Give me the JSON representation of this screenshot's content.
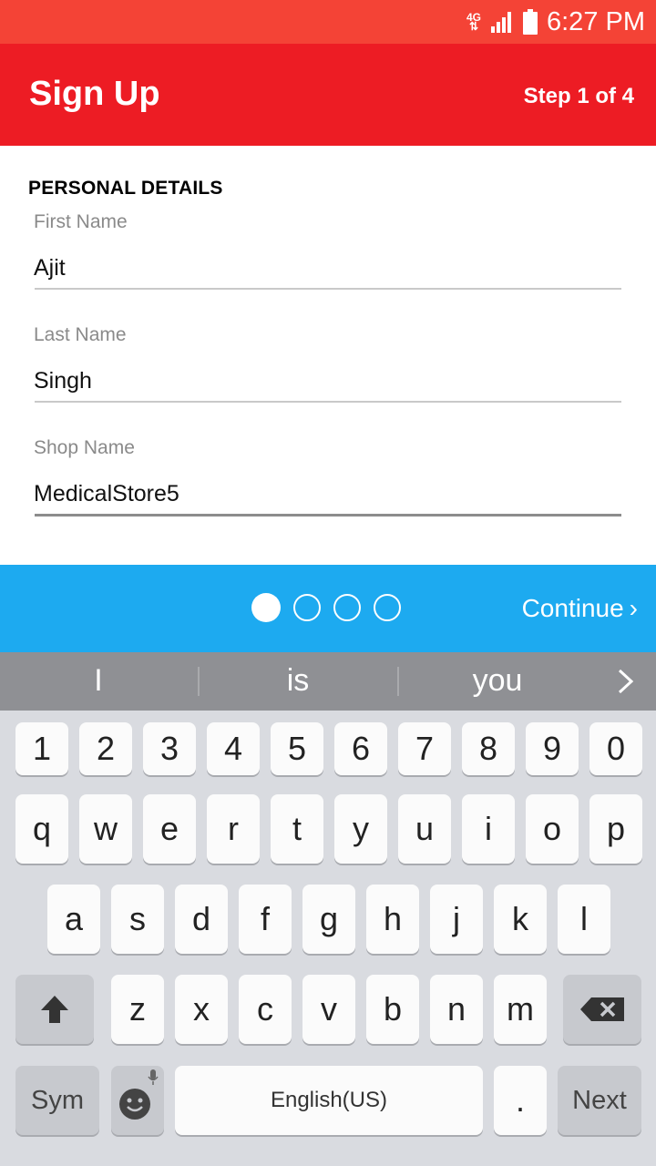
{
  "status": {
    "network": "4G",
    "time": "6:27 PM"
  },
  "header": {
    "title": "Sign Up",
    "step": "Step 1 of 4"
  },
  "form": {
    "section_title": "PERSONAL DETAILS",
    "fields": [
      {
        "label": "First Name",
        "value": "Ajit"
      },
      {
        "label": "Last Name",
        "value": "Singh"
      },
      {
        "label": "Shop Name",
        "value": "MedicalStore5"
      }
    ]
  },
  "pager": {
    "total_dots": 4,
    "active_index": 0,
    "continue_label": "Continue",
    "continue_glyph": "›"
  },
  "suggestions": {
    "items": [
      "I",
      "is",
      "you"
    ],
    "more_glyph": "›"
  },
  "keyboard": {
    "numbers": [
      "1",
      "2",
      "3",
      "4",
      "5",
      "6",
      "7",
      "8",
      "9",
      "0"
    ],
    "row1": [
      "q",
      "w",
      "e",
      "r",
      "t",
      "y",
      "u",
      "i",
      "o",
      "p"
    ],
    "row2": [
      "a",
      "s",
      "d",
      "f",
      "g",
      "h",
      "j",
      "k",
      "l"
    ],
    "row3": [
      "z",
      "x",
      "c",
      "v",
      "b",
      "n",
      "m"
    ],
    "sym_label": "Sym",
    "space_label": "English(US)",
    "period_label": ".",
    "next_label": "Next"
  },
  "colors": {
    "status_bar": "#f44336",
    "app_bar": "#ed1c24",
    "pager": "#1daaf0",
    "keyboard_bg": "#d9dbe0"
  }
}
